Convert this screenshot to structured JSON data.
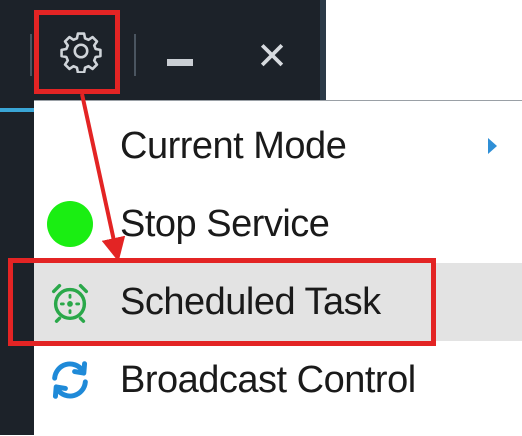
{
  "window": {
    "settings_button": "gear-icon",
    "minimize_button": "minimize-icon",
    "close_button_glyph": "✕"
  },
  "menu": {
    "items": [
      {
        "label": "Current Mode",
        "icon": "none",
        "has_submenu": true
      },
      {
        "label": "Stop Service",
        "icon": "green-status-dot"
      },
      {
        "label": "Scheduled Task",
        "icon": "alarm-clock-icon",
        "highlighted": true
      },
      {
        "label": "Broadcast Control",
        "icon": "refresh-arrows-icon"
      }
    ]
  },
  "annotation": {
    "highlight_color": "#e32424",
    "from": "settings_button",
    "to": "Scheduled Task"
  },
  "colors": {
    "titlebar": "#1c2229",
    "status_green": "#1aee12",
    "alarm_green": "#2aa84a",
    "refresh_blue": "#1f8ad8"
  }
}
